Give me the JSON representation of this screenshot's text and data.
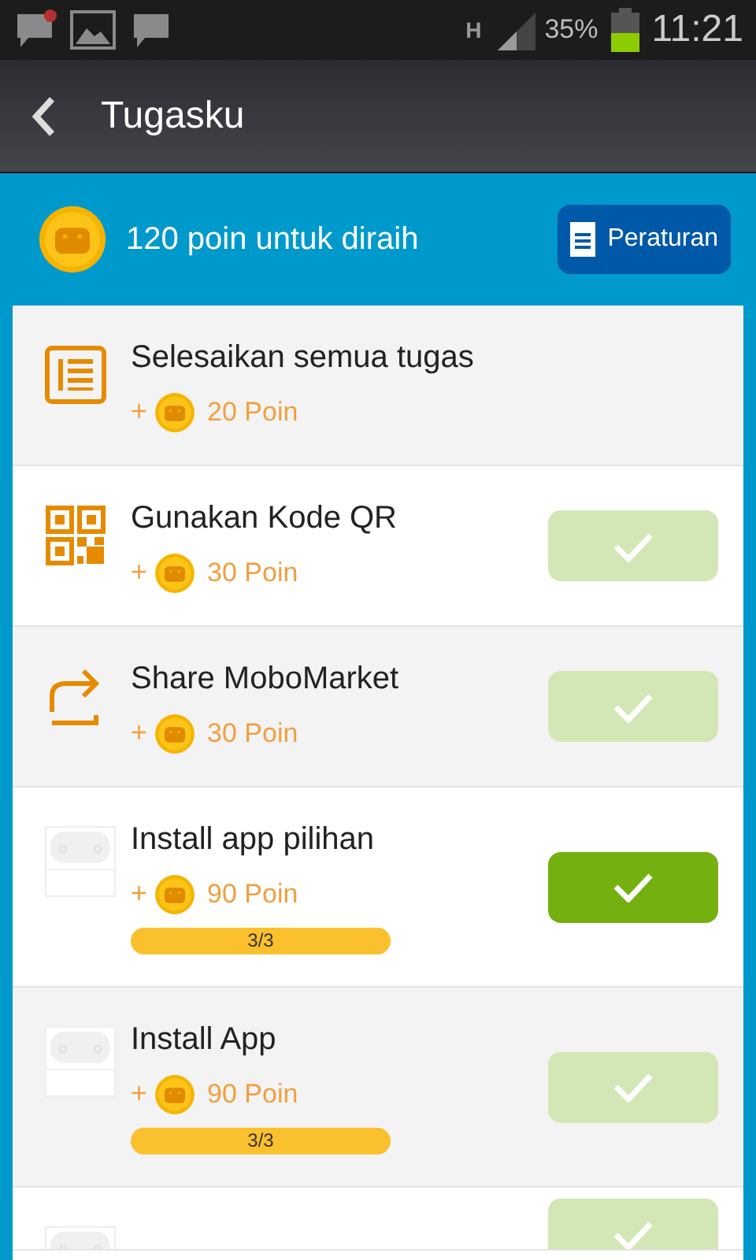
{
  "status_bar": {
    "network": "H",
    "battery": "35%",
    "time": "11:21"
  },
  "header": {
    "title": "Tugasku"
  },
  "summary": {
    "text": "120 poin untuk diraih",
    "rules_button": "Peraturan"
  },
  "tasks": [
    {
      "kind": "list",
      "title": "Selesaikan semua tugas",
      "plus": "+",
      "points": "20 Poin"
    },
    {
      "kind": "qr",
      "title": "Gunakan Kode QR",
      "plus": "+",
      "points": "30 Poin",
      "button": {
        "enabled": false
      }
    },
    {
      "kind": "share",
      "title": "Share MoboMarket",
      "plus": "+",
      "points": "30 Poin",
      "button": {
        "enabled": false
      }
    },
    {
      "kind": "app",
      "title": "Install app pilihan",
      "plus": "+",
      "points": "90 Poin",
      "progress": {
        "level": 1,
        "text": "3/3"
      },
      "button": {
        "enabled": true
      }
    },
    {
      "kind": "app",
      "title": "Install App",
      "plus": "+",
      "points": "90 Poin",
      "progress": {
        "level": 1,
        "text": "3/3"
      },
      "button": {
        "enabled": false
      }
    },
    {
      "kind": "app",
      "button": {
        "enabled": false
      }
    }
  ]
}
